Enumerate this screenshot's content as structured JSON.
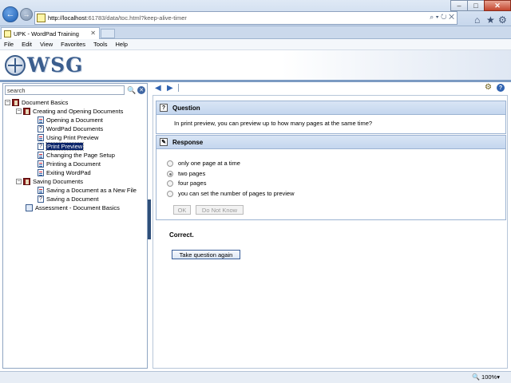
{
  "browser": {
    "url_host": "http://localhost",
    "url_rest": ":61783/data/toc.html?keep-alive-timer",
    "tab_title": "UPK - WordPad Training",
    "menus": [
      "File",
      "Edit",
      "View",
      "Favorites",
      "Tools",
      "Help"
    ],
    "zoom": "100%"
  },
  "header": {
    "logo_text": "WSG"
  },
  "sidebar": {
    "search_placeholder": "search",
    "tree": [
      {
        "label": "Document Basics",
        "icon": "book-icon",
        "expander": "−"
      },
      {
        "label": "Creating and Opening Documents",
        "icon": "book-icon",
        "expander": "−"
      },
      {
        "label": "Opening a Document",
        "icon": "topic-icon"
      },
      {
        "label": "WordPad Documents",
        "icon": "question-icon"
      },
      {
        "label": "Using Print Preview",
        "icon": "topic-icon"
      },
      {
        "label": "Print Preview",
        "icon": "question-icon",
        "selected": true
      },
      {
        "label": "Changing the Page Setup",
        "icon": "topic-icon"
      },
      {
        "label": "Printing a Document",
        "icon": "topic-icon"
      },
      {
        "label": "Exiting WordPad",
        "icon": "topic-icon"
      },
      {
        "label": "Saving Documents",
        "icon": "book-icon",
        "expander": "−"
      },
      {
        "label": "Saving a Document as a New File",
        "icon": "topic-icon"
      },
      {
        "label": "Saving a Document",
        "icon": "question-icon"
      },
      {
        "label": "Assessment - Document Basics",
        "icon": "assessment-icon"
      }
    ]
  },
  "question": {
    "heading": "Question",
    "text": "In print preview, you can preview up to how many pages at the same time?"
  },
  "response": {
    "heading": "Response",
    "options": [
      {
        "label": "only one page at a time",
        "checked": false
      },
      {
        "label": "two pages",
        "checked": true
      },
      {
        "label": "four pages",
        "checked": false
      },
      {
        "label": "you can set the number of pages to preview",
        "checked": false
      }
    ],
    "ok_label": "OK",
    "dont_know_label": "Do Not Know"
  },
  "feedback": "Correct.",
  "retry_label": "Take question again"
}
